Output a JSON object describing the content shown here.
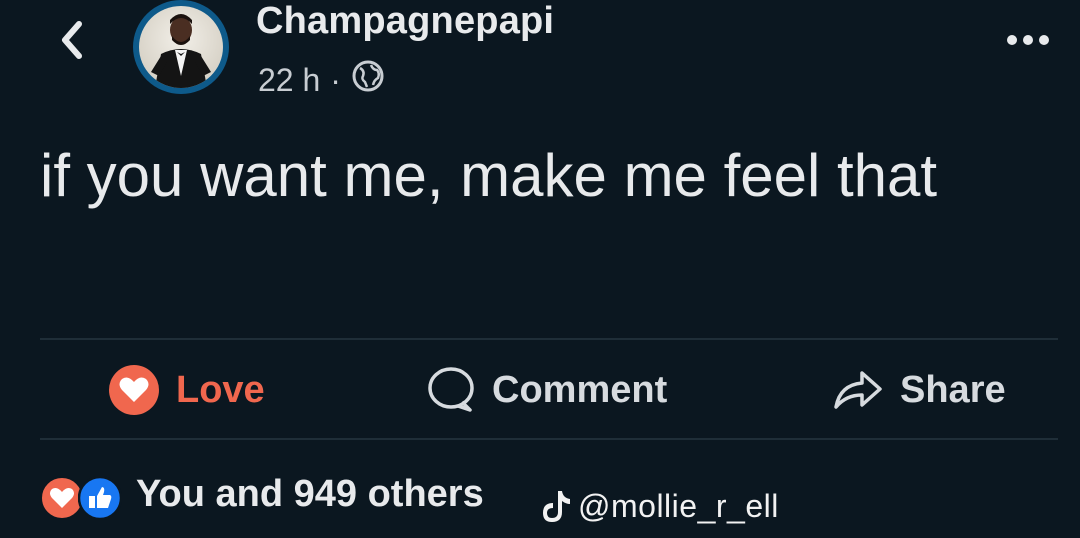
{
  "header": {
    "author_name": "Champagnepapi",
    "timestamp": "22 h",
    "separator": "·",
    "visibility_icon": "globe-icon",
    "back_icon": "chevron-left-icon",
    "more_icon": "more-horizontal-icon"
  },
  "post": {
    "text": "if you want me, make me feel that"
  },
  "actions": {
    "love_label": "Love",
    "comment_label": "Comment",
    "share_label": "Share"
  },
  "reactions": {
    "summary": "You and 949 others",
    "icons": [
      "love-reaction-icon",
      "like-reaction-icon"
    ]
  },
  "watermark": {
    "handle": "@mollie_r_ell",
    "icon": "tiktok-icon"
  },
  "colors": {
    "background": "#0b1720",
    "love_accent": "#f0674e",
    "like_blue": "#1877f2",
    "text_primary": "#e8eaec",
    "divider": "#1f2e38"
  }
}
